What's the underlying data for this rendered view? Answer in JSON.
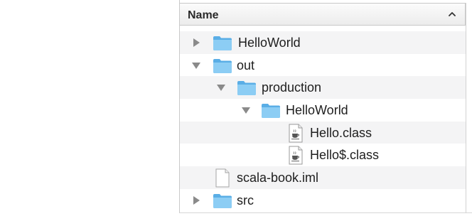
{
  "header": {
    "column_title": "Name",
    "sort_icon": "chevron-up-icon"
  },
  "rows": [
    {
      "label": "HelloWorld",
      "icon": "folder-icon",
      "disclosure": "collapsed"
    },
    {
      "label": "out",
      "icon": "folder-icon",
      "disclosure": "expanded"
    },
    {
      "label": "production",
      "icon": "folder-icon",
      "disclosure": "expanded"
    },
    {
      "label": "HelloWorld",
      "icon": "folder-icon",
      "disclosure": "expanded"
    },
    {
      "label": "Hello.class",
      "icon": "java-class-file-icon",
      "disclosure": "none"
    },
    {
      "label": "Hello$.class",
      "icon": "java-class-file-icon",
      "disclosure": "none"
    },
    {
      "label": "scala-book.iml",
      "icon": "document-icon",
      "disclosure": "none"
    },
    {
      "label": "src",
      "icon": "folder-icon",
      "disclosure": "collapsed"
    }
  ],
  "colors": {
    "folder": "#6cb8ea",
    "disclosure": "#8a8a8a",
    "alt_row": "#f4f4f5"
  }
}
